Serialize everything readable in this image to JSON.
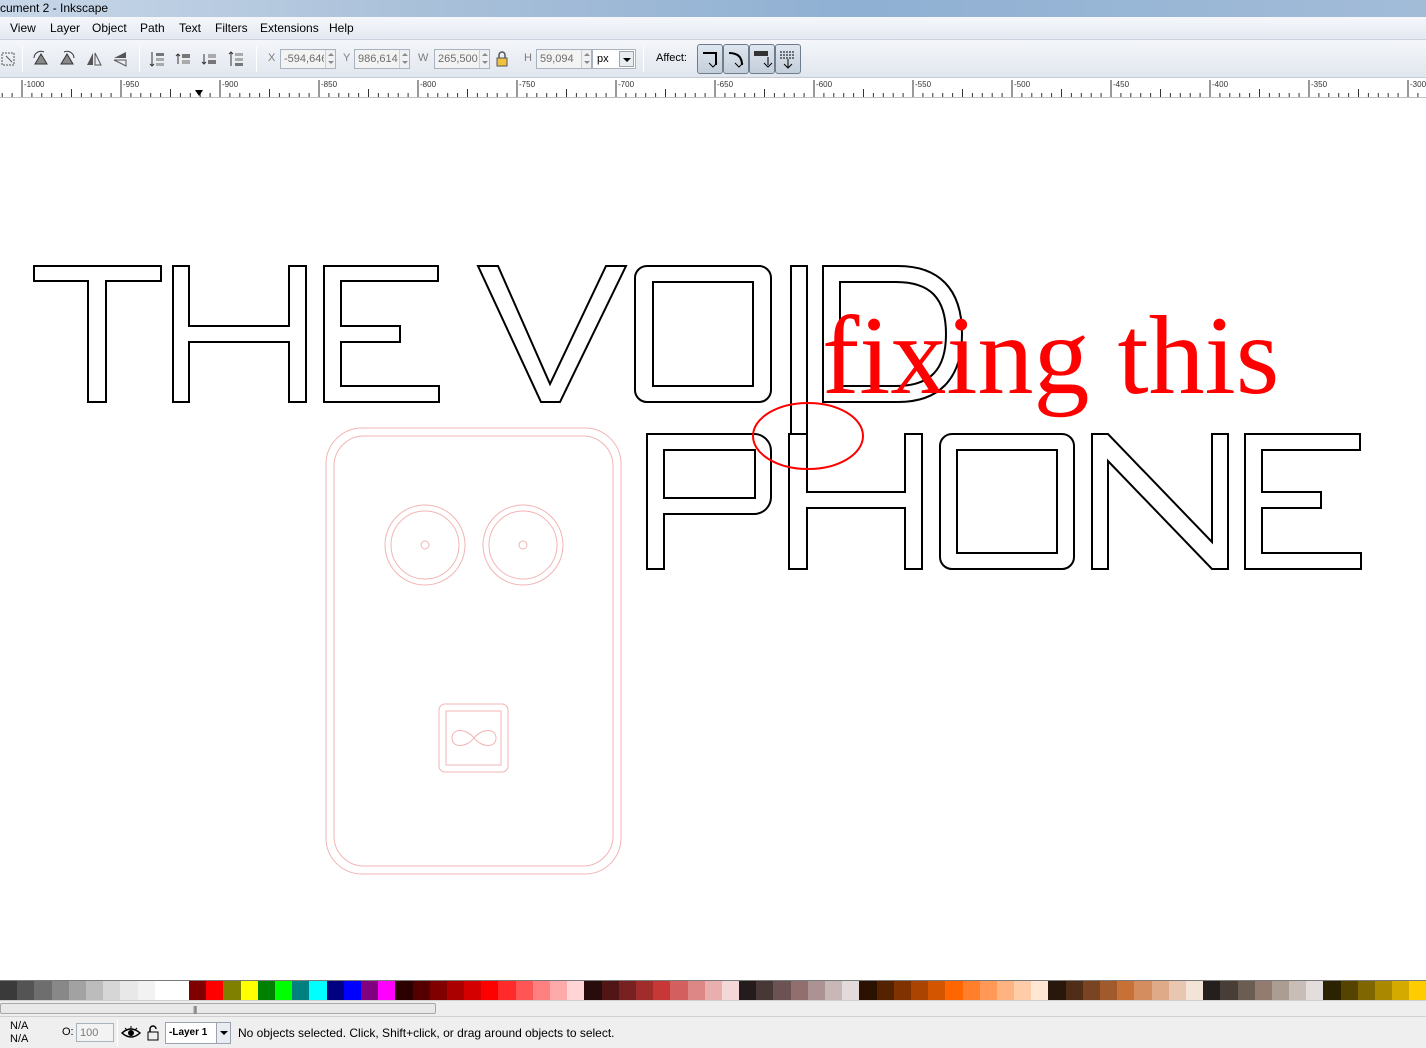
{
  "window": {
    "title": "cument 2 - Inkscape"
  },
  "menu": [
    {
      "label": "View",
      "key": "V"
    },
    {
      "label": "Layer",
      "key": "L"
    },
    {
      "label": "Object",
      "key": "O"
    },
    {
      "label": "Path",
      "key": "P"
    },
    {
      "label": "Text",
      "key": "T"
    },
    {
      "label": "Filters",
      "key": "r"
    },
    {
      "label": "Extensions",
      "key": "x"
    },
    {
      "label": "Help",
      "key": "H"
    }
  ],
  "toolbar": {
    "x_label": "X",
    "x_value": "-594,646",
    "y_label": "Y",
    "y_value": "986,614",
    "w_label": "W",
    "w_value": "265,500",
    "h_label": "H",
    "h_value": "59,094",
    "unit": "px",
    "affect_label": "Affect:"
  },
  "ruler": {
    "labels": [
      "-1000",
      "-950",
      "-900",
      "-850",
      "-800",
      "-750",
      "-700",
      "-650",
      "-600",
      "-550",
      "-500",
      "-450",
      "-400",
      "-350",
      "-300"
    ]
  },
  "canvas": {
    "line1": "THE VOID",
    "line2": "PHONE",
    "annotation": "fixing this",
    "annotation_color": "#ff0000"
  },
  "palette": [
    "#3a3a3a",
    "#545454",
    "#6e6e6e",
    "#888888",
    "#a2a2a2",
    "#bcbcbc",
    "#d6d6d6",
    "#e8e8e8",
    "#f2f2f2",
    "#ffffff",
    "#ffffff",
    "#800000",
    "#ff0000",
    "#808000",
    "#ffff00",
    "#008000",
    "#00ff00",
    "#008080",
    "#00ffff",
    "#000080",
    "#0000ff",
    "#800080",
    "#ff00ff",
    "#2b0000",
    "#550000",
    "#800000",
    "#aa0000",
    "#d40000",
    "#ff0000",
    "#ff2a2a",
    "#ff5555",
    "#ff8080",
    "#ffaaaa",
    "#ffd5d5",
    "#280b0b",
    "#501616",
    "#782121",
    "#a02c2c",
    "#c83737",
    "#d35f5f",
    "#de8787",
    "#e9afaf",
    "#f4d7d7",
    "#241c1c",
    "#483737",
    "#6c5353",
    "#916f6f",
    "#ac9393",
    "#c8b7b7",
    "#e3dbdb",
    "#2b1100",
    "#552200",
    "#803300",
    "#aa4400",
    "#d45500",
    "#ff6600",
    "#ff7f2a",
    "#ff9955",
    "#ffb380",
    "#ffccaa",
    "#ffe6d5",
    "#28170b",
    "#502d16",
    "#784421",
    "#a05a2c",
    "#c87137",
    "#d38d5f",
    "#deaa87",
    "#e9c6af",
    "#f4e3d7",
    "#241f1c",
    "#483e37",
    "#6c5d53",
    "#917c6f",
    "#ac9d93",
    "#c8beb7",
    "#e3dedb",
    "#2b2200",
    "#554400",
    "#806600",
    "#aa8800",
    "#d4aa00",
    "#ffcc00"
  ],
  "status": {
    "fill": "N/A",
    "stroke": "N/A",
    "opacity_label": "O:",
    "opacity_value": "100",
    "layer": "-Layer 1",
    "message": "No objects selected. Click, Shift+click, or drag around objects to select."
  }
}
